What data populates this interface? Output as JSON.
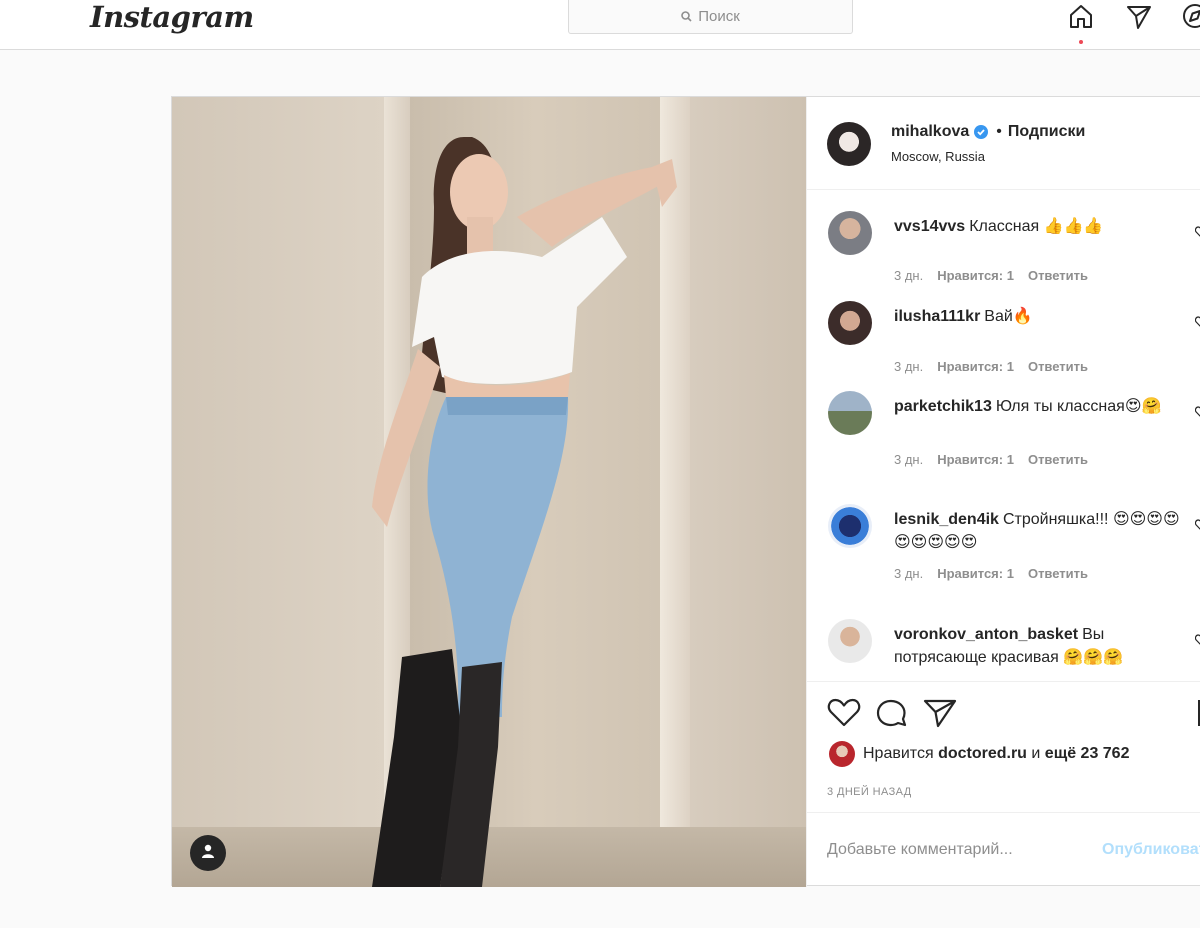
{
  "nav": {
    "logo": "Instagram",
    "search_placeholder": "Поиск",
    "icons": [
      "home-icon",
      "direct-icon",
      "explore-icon"
    ]
  },
  "post": {
    "user_tag_icon": "person-icon",
    "header": {
      "username": "mihalkova",
      "verified": true,
      "separator": "•",
      "follow_label": "Подписки",
      "location": "Moscow, Russia"
    },
    "comments": [
      {
        "user": "vvs14vvs",
        "text": "Классная 👍👍👍",
        "time": "3 дн.",
        "likes": "Нравится: 1",
        "reply": "Ответить"
      },
      {
        "user": "ilusha111kr",
        "text": "Вай🔥",
        "time": "3 дн.",
        "likes": "Нравится: 1",
        "reply": "Ответить"
      },
      {
        "user": "parketchik13",
        "text": "Юля ты классная😍🤗",
        "time": "3 дн.",
        "likes": "Нравится: 1",
        "reply": "Ответить"
      },
      {
        "user": "lesnik_den4ik",
        "text": "Стройняшка!!! 😍😍😍😍😍😍😍😍😍",
        "time": "3 дн.",
        "likes": "Нравится: 1",
        "reply": "Ответить"
      },
      {
        "user": "voronkov_anton_basket",
        "text": "Вы потрясающе красивая 🤗🤗🤗",
        "time": "",
        "likes": "",
        "reply": ""
      }
    ],
    "likes": {
      "prefix": "Нравится",
      "liker": "doctored.ru",
      "middle": "и",
      "count": "ещё 23 762"
    },
    "date": "3 ДНЕЙ НАЗАД",
    "add_comment": {
      "placeholder": "Добавьте комментарий...",
      "publish_label": "Опубликовать"
    }
  },
  "colors": {
    "accent": "#0095f6",
    "publish_disabled": "#b2dffc",
    "verified": "#3897f0",
    "notification": "#ed4956"
  }
}
